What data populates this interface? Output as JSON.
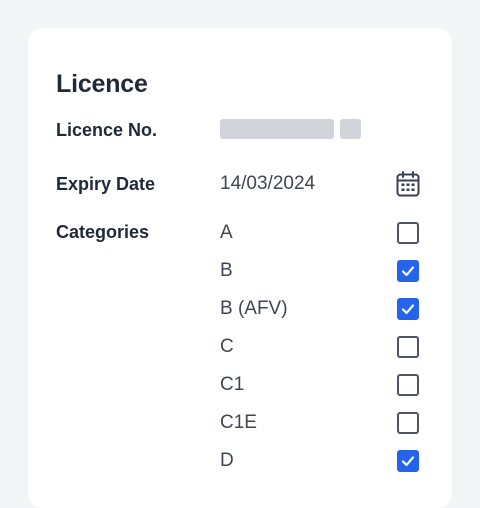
{
  "licence": {
    "title": "Licence",
    "number_label": "Licence No.",
    "expiry_label": "Expiry Date",
    "expiry_value": "14/03/2024",
    "categories_label": "Categories",
    "categories": [
      {
        "name": "A",
        "checked": false
      },
      {
        "name": "B",
        "checked": true
      },
      {
        "name": "B (AFV)",
        "checked": true
      },
      {
        "name": "C",
        "checked": false
      },
      {
        "name": "C1",
        "checked": false
      },
      {
        "name": "C1E",
        "checked": false
      },
      {
        "name": "D",
        "checked": true
      }
    ]
  },
  "colors": {
    "accent": "#2563eb",
    "text": "#1f2937",
    "redaction": "#d1d5db"
  },
  "icons": {
    "expiry": "calendar-icon",
    "checked": "checkmark-icon"
  }
}
